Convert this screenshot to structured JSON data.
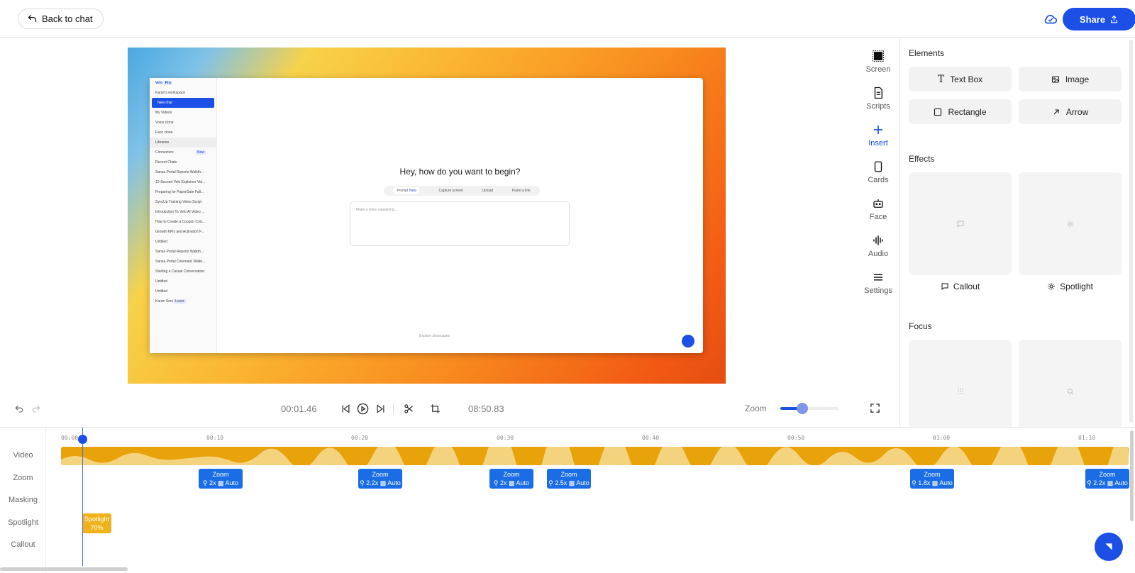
{
  "header": {
    "back_label": "Back to chat",
    "share_label": "Share"
  },
  "preview": {
    "app_name": "Velo",
    "badge": "Pro",
    "workspace": "Karan's workspace",
    "new_chat": "New chat",
    "nav": [
      "My Videos",
      "Voice clone",
      "Face clone",
      "Libraries",
      "Connectors"
    ],
    "connectors_badge": "New",
    "recent_label": "Recent Chats",
    "recent": [
      "Sansa Portal Reports Walkth...",
      "10-Second Velo Explainer Vid...",
      "Preparing for PaperGate Fall...",
      "SyncUp Training Video Script",
      "Introduction To Velo AI Video ...",
      "How to Create a Coupon Cod...",
      "Growth KPIs and Activation F...",
      "Untitled",
      "Sansa Portal Reports Walkth...",
      "Sansa Portal Cinematic Walkt...",
      "Starting a Casual Conversation",
      "Untitled",
      "Untitled"
    ],
    "user_name": "Karan Soni",
    "user_badge": "Lover",
    "greeting": "Hey, how do you want to begin?",
    "tabs": [
      "Prompt",
      "Capture screen",
      "Upload",
      "Paste a link"
    ],
    "prompt_badge": "New",
    "input_placeholder": "Make a video explaining...",
    "explore": "Explore showcases"
  },
  "tools": [
    {
      "label": "Screen",
      "icon": "screen-icon"
    },
    {
      "label": "Scripts",
      "icon": "script-icon"
    },
    {
      "label": "Insert",
      "icon": "plus-icon"
    },
    {
      "label": "Cards",
      "icon": "card-icon"
    },
    {
      "label": "Face",
      "icon": "robot-icon"
    },
    {
      "label": "Audio",
      "icon": "waveform-icon"
    },
    {
      "label": "Settings",
      "icon": "menu-icon"
    }
  ],
  "panel": {
    "elements_title": "Elements",
    "elements": [
      {
        "label": "Text Box",
        "icon": "text-icon"
      },
      {
        "label": "Image",
        "icon": "image-icon"
      },
      {
        "label": "Rectangle",
        "icon": "rectangle-icon"
      },
      {
        "label": "Arrow",
        "icon": "arrow-icon"
      }
    ],
    "effects_title": "Effects",
    "effects": [
      {
        "label": "Callout",
        "icon": "callout-icon"
      },
      {
        "label": "Spotlight",
        "icon": "spotlight-icon"
      }
    ],
    "focus_title": "Focus"
  },
  "controls": {
    "current_time": "00:01.46",
    "total_time": "08:50.83",
    "zoom_label": "Zoom",
    "zoom_level": 0.38
  },
  "timeline": {
    "tracks": [
      "Video",
      "Zoom",
      "Masking",
      "Spotlight",
      "Callout"
    ],
    "ticks": [
      "00:00",
      "00:10",
      "00:20",
      "00:30",
      "00:40",
      "00:50",
      "01:00",
      "01:10"
    ],
    "zoom_clips": [
      {
        "title": "Zoom",
        "level": "2x",
        "mode": "Auto"
      },
      {
        "title": "Zoom",
        "level": "2.2x",
        "mode": "Auto"
      },
      {
        "title": "Zoom",
        "level": "2x",
        "mode": "Auto"
      },
      {
        "title": "Zoom",
        "level": "2.5x",
        "mode": "Auto"
      },
      {
        "title": "Zoom",
        "level": "1.8x",
        "mode": "Auto"
      },
      {
        "title": "Zoom",
        "level": "2.2x",
        "mode": "Auto"
      }
    ],
    "spotlight_clip": {
      "title": "Spotlight",
      "value": "70%"
    }
  }
}
